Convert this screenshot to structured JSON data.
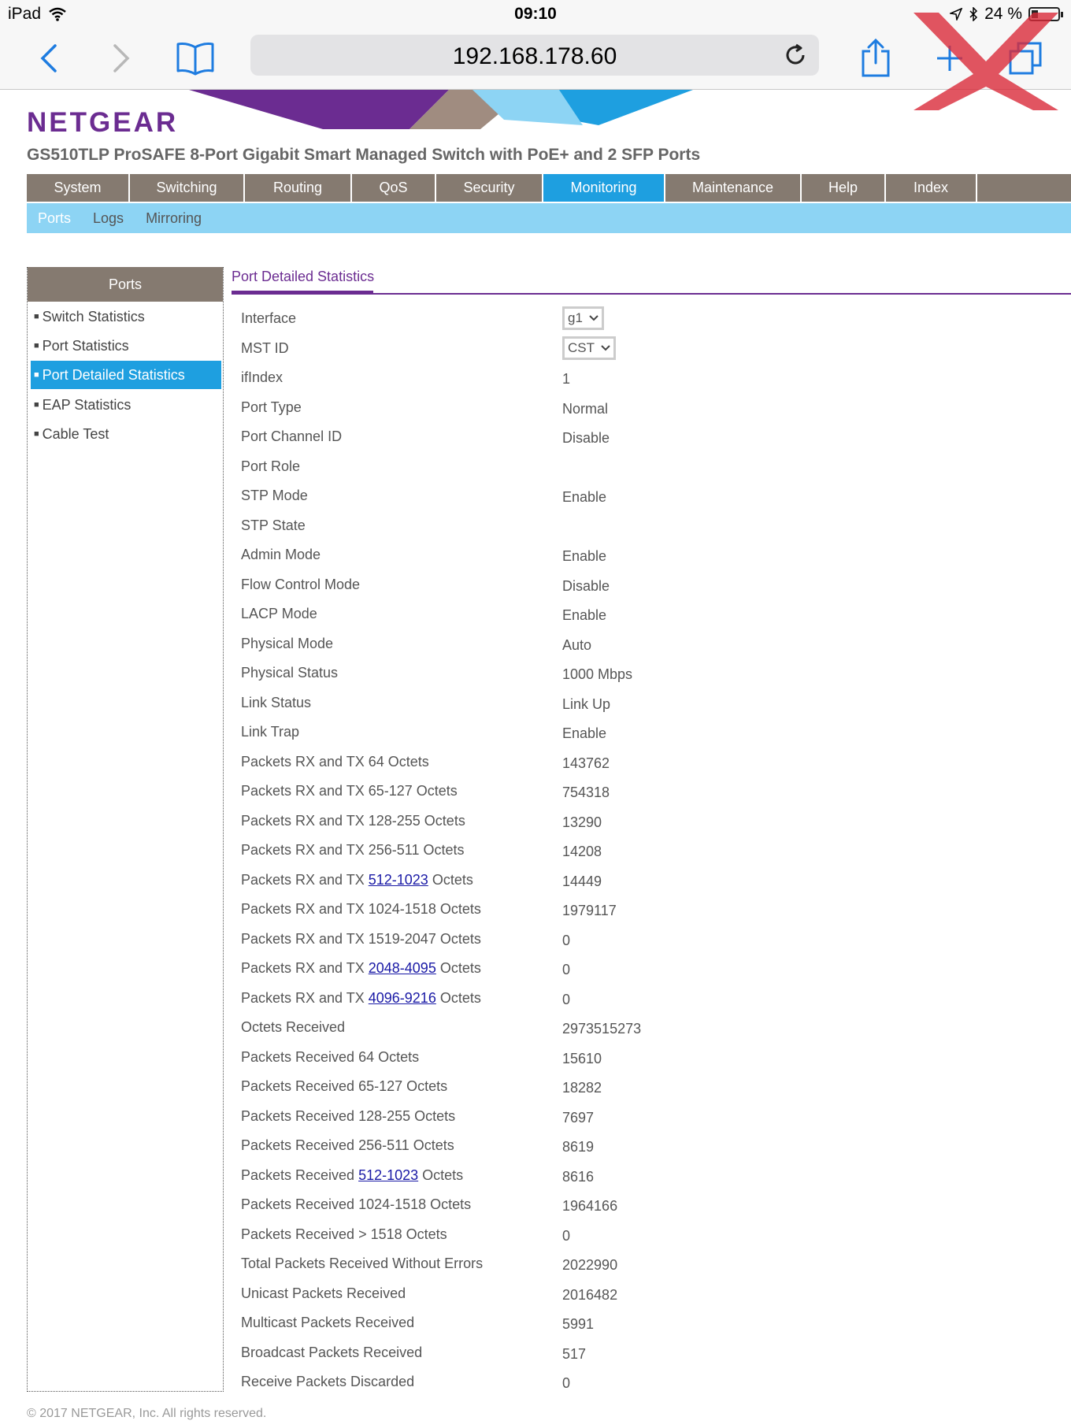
{
  "status_bar": {
    "device": "iPad",
    "time": "09:10",
    "battery": "24 %"
  },
  "browser": {
    "url": "192.168.178.60"
  },
  "header": {
    "logo": "NETGEAR",
    "product": "GS510TLP ProSAFE 8-Port Gigabit Smart Managed Switch with PoE+ and 2 SFP Ports"
  },
  "main_nav": [
    {
      "label": "System",
      "active": false
    },
    {
      "label": "Switching",
      "active": false
    },
    {
      "label": "Routing",
      "active": false
    },
    {
      "label": "QoS",
      "active": false
    },
    {
      "label": "Security",
      "active": false
    },
    {
      "label": "Monitoring",
      "active": true
    },
    {
      "label": "Maintenance",
      "active": false
    },
    {
      "label": "Help",
      "active": false
    },
    {
      "label": "Index",
      "active": false
    }
  ],
  "sub_nav": [
    {
      "label": "Ports",
      "active": true
    },
    {
      "label": "Logs",
      "active": false
    },
    {
      "label": "Mirroring",
      "active": false
    }
  ],
  "sidebar": {
    "title": "Ports",
    "items": [
      {
        "label": "Switch Statistics",
        "active": false
      },
      {
        "label": "Port Statistics",
        "active": false
      },
      {
        "label": "Port Detailed Statistics",
        "active": true
      },
      {
        "label": "EAP Statistics",
        "active": false
      },
      {
        "label": "Cable Test",
        "active": false
      }
    ]
  },
  "content": {
    "title": "Port Detailed Statistics",
    "interface_label": "Interface",
    "interface_value": "g1",
    "mst_label": "MST ID",
    "mst_value": "CST",
    "rows": [
      {
        "label": "ifIndex",
        "value": "1"
      },
      {
        "label": "Port Type",
        "value": "Normal"
      },
      {
        "label": "Port Channel ID",
        "value": "Disable"
      },
      {
        "label": "Port Role",
        "value": ""
      },
      {
        "label": "STP Mode",
        "value": "Enable"
      },
      {
        "label": "STP State",
        "value": ""
      },
      {
        "label": "Admin Mode",
        "value": "Enable"
      },
      {
        "label": "Flow Control Mode",
        "value": "Disable"
      },
      {
        "label": "LACP Mode",
        "value": "Enable"
      },
      {
        "label": "Physical Mode",
        "value": "Auto"
      },
      {
        "label": "Physical Status",
        "value": "1000 Mbps"
      },
      {
        "label": "Link Status",
        "value": "Link Up"
      },
      {
        "label": "Link Trap",
        "value": "Enable"
      },
      {
        "label": "Packets RX and TX 64 Octets",
        "value": "143762"
      },
      {
        "label": "Packets RX and TX 65-127 Octets",
        "value": "754318"
      },
      {
        "label": "Packets RX and TX 128-255 Octets",
        "value": "13290"
      },
      {
        "label": "Packets RX and TX 256-511 Octets",
        "value": "14208"
      },
      {
        "label_pre": "Packets RX and TX ",
        "label_link": "512-1023",
        "label_post": " Octets",
        "value": "14449"
      },
      {
        "label": "Packets RX and TX 1024-1518 Octets",
        "value": "1979117"
      },
      {
        "label": "Packets RX and TX 1519-2047 Octets",
        "value": "0"
      },
      {
        "label_pre": "Packets RX and TX ",
        "label_link": "2048-4095",
        "label_post": " Octets",
        "value": "0"
      },
      {
        "label_pre": "Packets RX and TX ",
        "label_link": "4096-9216",
        "label_post": " Octets",
        "value": "0"
      },
      {
        "label": "Octets Received",
        "value": "2973515273"
      },
      {
        "label": "Packets Received 64 Octets",
        "value": "15610"
      },
      {
        "label": "Packets Received 65-127 Octets",
        "value": "18282"
      },
      {
        "label": "Packets Received 128-255 Octets",
        "value": "7697"
      },
      {
        "label": "Packets Received 256-511 Octets",
        "value": "8619"
      },
      {
        "label_pre": "Packets Received ",
        "label_link": "512-1023",
        "label_post": " Octets",
        "value": "8616"
      },
      {
        "label": "Packets Received 1024-1518 Octets",
        "value": "1964166"
      },
      {
        "label": "Packets Received > 1518 Octets",
        "value": "0"
      },
      {
        "label": "Total Packets Received Without Errors",
        "value": "2022990"
      },
      {
        "label": "Unicast Packets Received",
        "value": "2016482"
      },
      {
        "label": "Multicast Packets Received",
        "value": "5991"
      },
      {
        "label": "Broadcast Packets Received",
        "value": "517"
      },
      {
        "label": "Receive Packets Discarded",
        "value": "0"
      }
    ]
  },
  "footer": "© 2017 NETGEAR, Inc. All rights reserved.",
  "colors": {
    "brand_purple": "#6b2c91",
    "nav_gray": "#857a70",
    "active_blue": "#1e9fe0",
    "subnav_blue": "#8dd4f4",
    "link_blue": "#1a1aa6"
  }
}
